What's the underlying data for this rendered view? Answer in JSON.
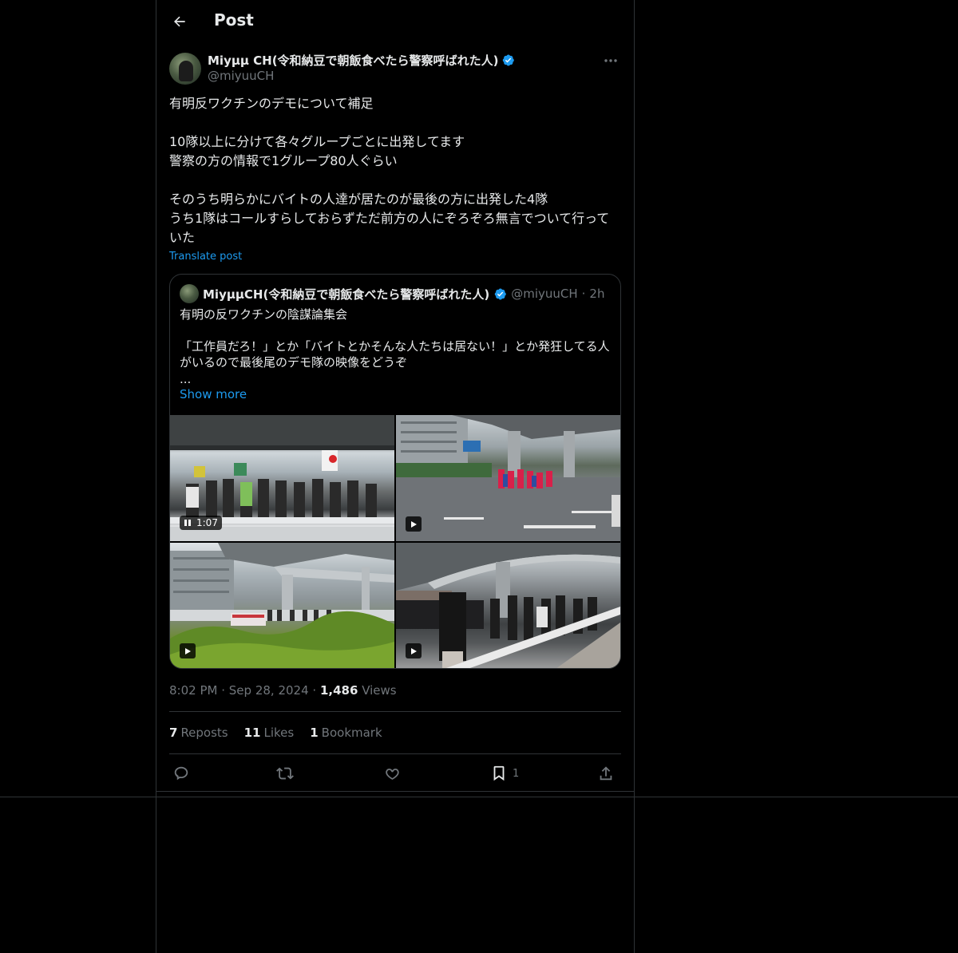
{
  "header": {
    "title": "Post"
  },
  "post": {
    "author_name": "Miyμμ CH(令和納豆で朝飯食べたら警察呼ばれた人)",
    "author_handle": "@miyuuCH",
    "text": "有明反ワクチンのデモについて補足\n\n10隊以上に分けて各々グループごとに出発してます\n警察の方の情報で1グループ80人ぐらい\n\nそのうち明らかにバイトの人達が居たのが最後の方に出発した4隊\nうち1隊はコールすらしておらずただ前方の人にぞろぞろ無言でついて行っていた",
    "translate_label": "Translate post",
    "time": "8:02 PM",
    "date": "Sep 28, 2024",
    "views_count": "1,486",
    "views_label": "Views",
    "reposts_count": "7",
    "reposts_label": "Reposts",
    "likes_count": "11",
    "likes_label": "Likes",
    "bookmarks_count": "1",
    "bookmarks_label": "Bookmark",
    "bookmark_action_count": "1"
  },
  "quote": {
    "author_name": "MiyμμCH(令和納豆で朝飯食べたら警察呼ばれた人)",
    "author_handle": "@miyuuCH",
    "age": "2h",
    "text": "有明の反ワクチンの陰謀論集会\n\n「工作員だろ！」とか「バイトとかそんな人たちは居ない！」とか発狂してる人がいるので最後尾のデモ隊の映像をどうぞ",
    "ellipsis": "...",
    "show_more": "Show more",
    "video_duration": "1:07"
  },
  "colors": {
    "accent": "#1d9bf0",
    "verified": "#1d9bf0",
    "muted": "#71767b",
    "border": "#2f3336",
    "text": "#e7e9ea",
    "background": "#000000"
  },
  "icons": [
    "arrow-left-icon",
    "verified-icon",
    "more-icon",
    "pause-icon",
    "play-icon",
    "reply-icon",
    "repost-icon",
    "like-icon",
    "bookmark-icon",
    "share-icon"
  ]
}
